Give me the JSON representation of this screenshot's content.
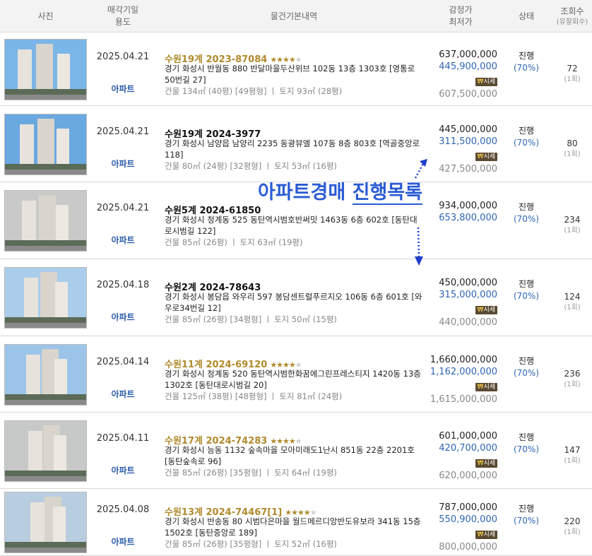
{
  "header": {
    "photo": "사진",
    "date_line1": "매각기일",
    "date_line2": "용도",
    "info": "물건기본내역",
    "price_line1": "감정가",
    "price_line2": "최저가",
    "status": "상태",
    "views_line1": "조회수",
    "views_line2": "(유찰회수)"
  },
  "overlay": {
    "text_a": "아파트경매",
    "text_b": "진행목록"
  },
  "rows": [
    {
      "date": "2025.04.21",
      "use": "아파트",
      "case": "수원19계 2023-87084",
      "gold": true,
      "stars": "★★★★",
      "stars_off": "★",
      "addr": "경기 화성시 반월동 880 반달마을두산위브 102동 13층 1303호 [영통로 50번길 27]",
      "area": "건물 134㎡ (40평) [49평형]  ㅣ  토지 93㎡ (28평)",
      "appraisal": "637,000,000",
      "minimum": "445,900,000",
      "badge": "시세",
      "third": "607,500,000",
      "status": "진행",
      "ratio": "(70%)",
      "views": "72",
      "fails": "(1회)"
    },
    {
      "date": "2025.04.21",
      "use": "아파트",
      "case": "수원19계 2024-3977",
      "gold": false,
      "stars": "",
      "stars_off": "",
      "addr": "경기 화성시 남양읍 남양리 2235 동광뷰엘 107동 8층 803호 [역골중앙로 118]",
      "area": "건물 80㎡ (24평) [32평형]  ㅣ  토지 53㎡ (16평)",
      "appraisal": "445,000,000",
      "minimum": "311,500,000",
      "badge": "시세",
      "third": "427,500,000",
      "status": "진행",
      "ratio": "(70%)",
      "views": "80",
      "fails": "(1회)"
    },
    {
      "date": "2025.04.21",
      "use": "아파트",
      "case": "수원5계 2024-61850",
      "gold": false,
      "stars": "",
      "stars_off": "",
      "addr": "경기 화성시 청계동 525 동탄역시범호반써밋 1463동 6층 602호 [동탄대로시범길 122]",
      "area": "건물 85㎡ (26평)  ㅣ  토지 63㎡ (19평)",
      "appraisal": "934,000,000",
      "minimum": "653,800,000",
      "badge": "",
      "third": "",
      "status": "진행",
      "ratio": "(70%)",
      "views": "234",
      "fails": "(1회)"
    },
    {
      "date": "2025.04.18",
      "use": "아파트",
      "case": "수원2계 2024-78643",
      "gold": false,
      "stars": "",
      "stars_off": "",
      "addr": "경기 화성시 봉담읍 와우리 597 봉담센트럴푸르지오 106동 6층 601호 [와우로34번길 12]",
      "area": "건물 85㎡ (26평) [34평형]  ㅣ  토지 50㎡ (15평)",
      "appraisal": "450,000,000",
      "minimum": "315,000,000",
      "badge": "시세",
      "third": "440,000,000",
      "status": "진행",
      "ratio": "(70%)",
      "views": "124",
      "fails": "(1회)"
    },
    {
      "date": "2025.04.14",
      "use": "아파트",
      "case": "수원11계 2024-69120",
      "gold": true,
      "stars": "★★★★",
      "stars_off": "★",
      "addr": "경기 화성시 청계동 520 동탄역시범한화꿈에그린프레스티지 1420동 13층 1302호 [동탄대로시범길 20]",
      "area": "건물 125㎡ (38평) [48평형]  ㅣ  토지 81㎡ (24평)",
      "appraisal": "1,660,000,000",
      "minimum": "1,162,000,000",
      "badge": "시세",
      "third": "1,615,000,000",
      "status": "진행",
      "ratio": "(70%)",
      "views": "236",
      "fails": "(1회)"
    },
    {
      "date": "2025.04.11",
      "use": "아파트",
      "case": "수원17계 2024-74283",
      "gold": true,
      "stars": "★★★★",
      "stars_off": "★",
      "addr": "경기 화성시 능동 1132 숲속마을 모아미래도1난시 851동 22층 2201호 [동탄숲속로 96]",
      "area": "건물 85㎡ (26평) [35평형]  ㅣ  토지 64㎡ (19평)",
      "appraisal": "601,000,000",
      "minimum": "420,700,000",
      "badge": "시세",
      "third": "620,000,000",
      "status": "진행",
      "ratio": "(70%)",
      "views": "147",
      "fails": "(1회)"
    },
    {
      "date": "2025.04.08",
      "use": "아파트",
      "case": "수원13계 2024-74467[1]",
      "gold": true,
      "stars": "★★★★",
      "stars_off": "★",
      "addr": "경기 화성시 반송동 80 시범다은마을 월드메르디앙반도유보라 341동 15층 1502호 [동탄중앙로 189]",
      "area": "건물 85㎡ (26평) [35평형]  ㅣ  토지 52㎡ (16평)",
      "appraisal": "787,000,000",
      "minimum": "550,900,000",
      "badge": "시세",
      "third": "800,000,000",
      "status": "진행",
      "ratio": "(70%)",
      "views": "220",
      "fails": "(1회)"
    }
  ]
}
